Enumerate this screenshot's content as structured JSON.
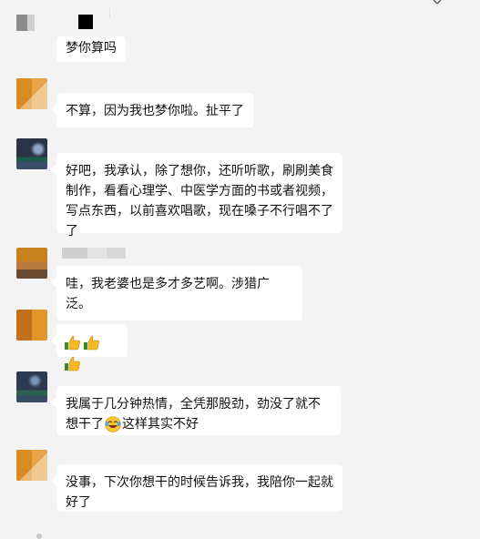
{
  "chat": {
    "partial_message": "梦你算吗",
    "messages": [
      {
        "text": "不算，因为我也梦你啦。扯平了"
      },
      {
        "text": "好吧，我承认，除了想你，还听听歌，刷刷美食制作，看看心理学、中医学方面的书或者视频，写点东西，以前喜欢唱歌，现在嗓子不行唱不了了"
      },
      {
        "text": "哇，我老婆也是多才多艺啊。涉猎广泛。"
      },
      {
        "emoji": [
          "thumbs-up",
          "thumbs-up",
          "thumbs-up"
        ]
      },
      {
        "text_before": "我属于几分钟热情，全凭那股劲，劲没了就不想干了",
        "emoji": "laugh-cry",
        "text_after": "这样其实不好"
      },
      {
        "text": "没事，下次你想干的时候告诉我，我陪你一起就好了"
      }
    ]
  },
  "colors": {
    "background": "#f3f3f3",
    "bubble": "#ffffff",
    "text": "#111111"
  }
}
